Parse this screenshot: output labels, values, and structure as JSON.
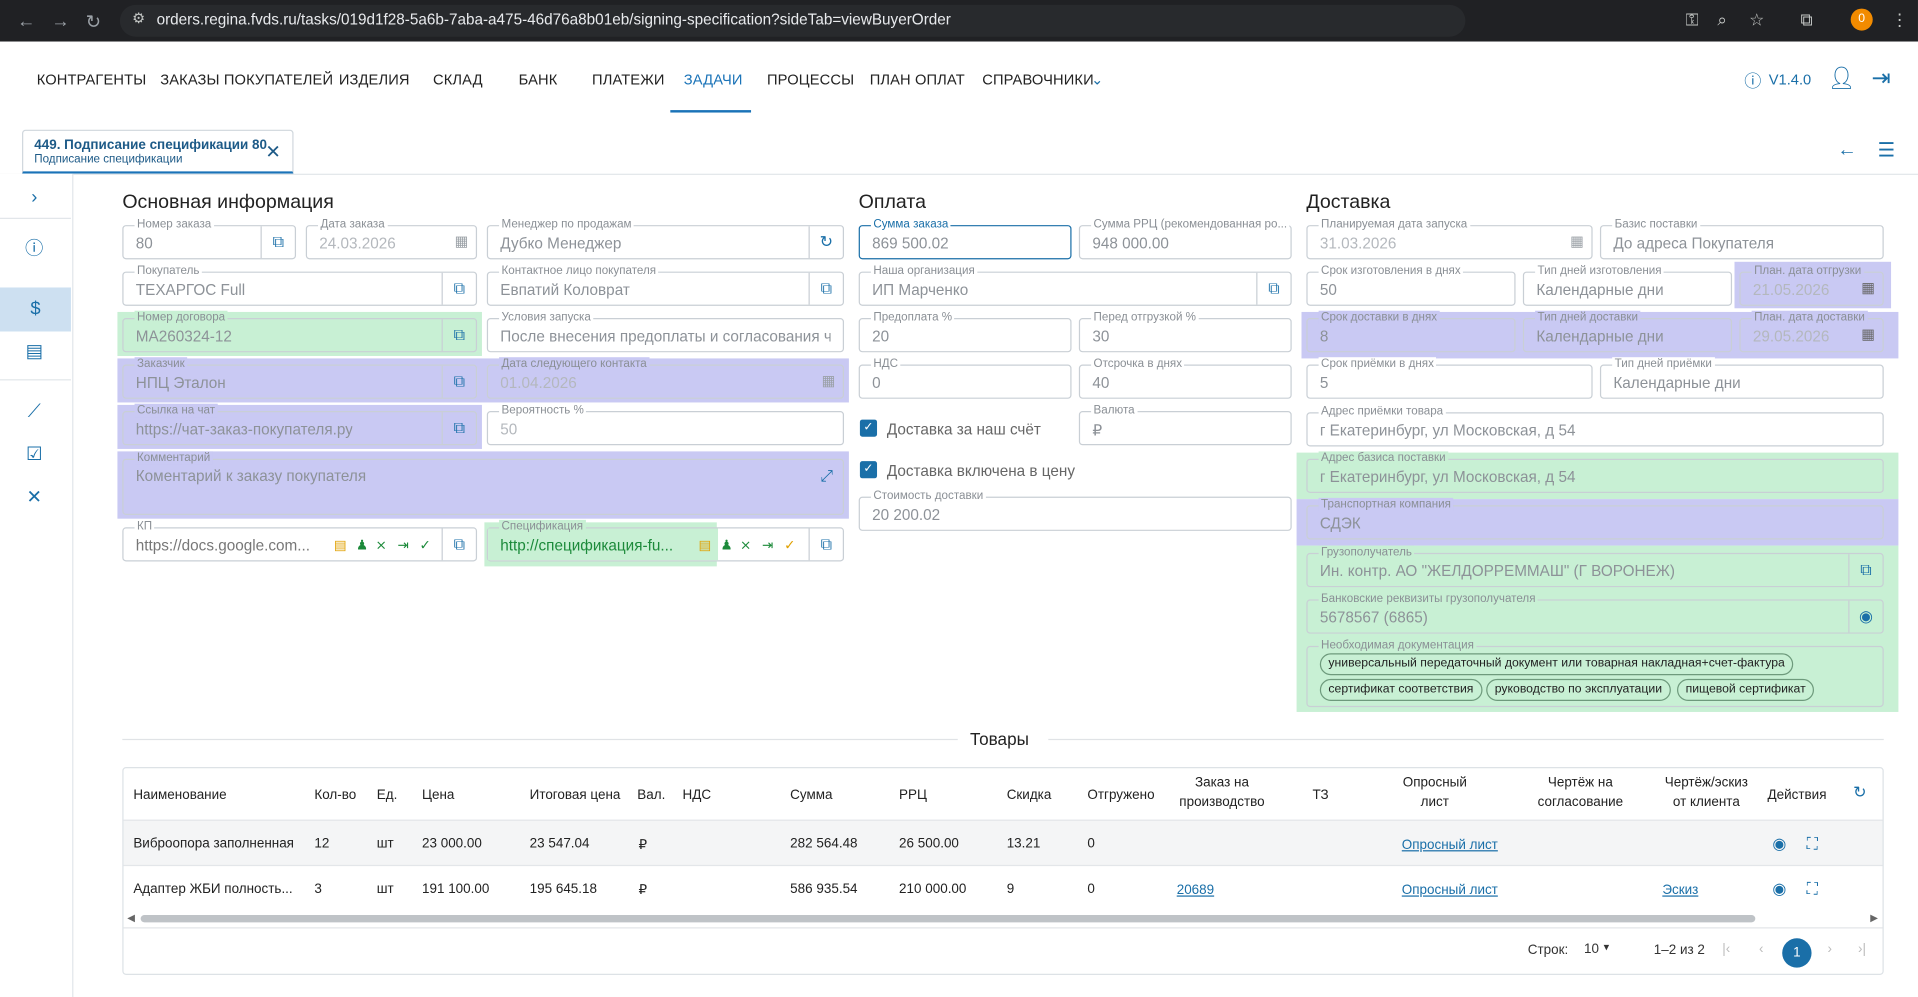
{
  "browser": {
    "url": "orders.regina.fvds.ru/tasks/019d1f28-5a6b-7aba-a475-46d76a8b01eb/signing-specification?sideTab=viewBuyerOrder",
    "profile": "0"
  },
  "nav": {
    "items": [
      "КОНТРАГЕНТЫ",
      "ЗАКАЗЫ ПОКУПАТЕЛЕЙ",
      "ИЗДЕЛИЯ",
      "СКЛАД",
      "БАНК",
      "ПЛАТЕЖИ",
      "ЗАДАЧИ",
      "ПРОЦЕССЫ",
      "ПЛАН ОПЛАТ",
      "СПРАВОЧНИКИ"
    ],
    "active": "ЗАДАЧИ",
    "version": "V1.4.0"
  },
  "tab": {
    "title": "449. Подписание спецификации 80",
    "subtitle": "Подписание спецификации"
  },
  "sections": {
    "main": "Основная информация",
    "payment": "Оплата",
    "delivery": "Доставка",
    "goods": "Товары"
  },
  "main": {
    "order_number": {
      "label": "Номер заказа",
      "value": "80"
    },
    "order_date": {
      "label": "Дата заказа",
      "value": "24.03.2026"
    },
    "manager": {
      "label": "Менеджер по продажам",
      "value": "Дубко Менеджер"
    },
    "buyer": {
      "label": "Покупатель",
      "value": "ТЕХАРГОС Full"
    },
    "contact": {
      "label": "Контактное лицо покупателя",
      "value": "Евпатий Коловрат"
    },
    "contract": {
      "label": "Номер договора",
      "value": "МА260324-12"
    },
    "launch_terms": {
      "label": "Условия запуска",
      "value": "После внесения предоплаты и согласования чертежей"
    },
    "customer": {
      "label": "Заказчик",
      "value": "НПЦ Эталон"
    },
    "next_contact": {
      "label": "Дата следующего контакта",
      "value": "01.04.2026"
    },
    "chat": {
      "label": "Ссылка на чат",
      "value": "https://чат-заказ-покупателя.ру"
    },
    "probability": {
      "label": "Вероятность %",
      "value": "50"
    },
    "comment": {
      "label": "Комментарий",
      "value": "Коментарий к заказу покупателя"
    },
    "kp": {
      "label": "КП",
      "value": "https://docs.google.com..."
    },
    "spec": {
      "label": "Спецификация",
      "value": "http://спецификация-fu..."
    }
  },
  "payment": {
    "sum": {
      "label": "Сумма заказа",
      "value": "869 500.02"
    },
    "rrp_sum": {
      "label": "Сумма РРЦ (рекомендованная ро...",
      "value": "948 000.00"
    },
    "org": {
      "label": "Наша организация",
      "value": "ИП Марченко"
    },
    "prepay": {
      "label": "Предоплата %",
      "value": "20"
    },
    "before_ship": {
      "label": "Перед отгрузкой %",
      "value": "30"
    },
    "vat": {
      "label": "НДС",
      "value": "0"
    },
    "deferral": {
      "label": "Отсрочка в днях",
      "value": "40"
    },
    "delivery_ours": {
      "label": "Доставка за наш счёт",
      "checked": true
    },
    "currency": {
      "label": "Валюта",
      "value": "₽"
    },
    "delivery_incl": {
      "label": "Доставка включена в цену",
      "checked": true
    },
    "delivery_cost": {
      "label": "Стоимость доставки",
      "value": "20 200.02"
    }
  },
  "delivery": {
    "launch_date": {
      "label": "Планируемая дата запуска",
      "value": "31.03.2026"
    },
    "basis": {
      "label": "Базис поставки",
      "value": "До адреса Покупателя"
    },
    "mfg_days": {
      "label": "Срок изготовления в днях",
      "value": "50"
    },
    "mfg_type": {
      "label": "Тип дней изготовления",
      "value": "Календарные дни"
    },
    "ship_date": {
      "label": "План. дата отгрузки",
      "value": "21.05.2026"
    },
    "dlv_days": {
      "label": "Срок доставки в днях",
      "value": "8"
    },
    "dlv_type": {
      "label": "Тип дней доставки",
      "value": "Календарные дни"
    },
    "dlv_date": {
      "label": "План. дата доставки",
      "value": "29.05.2026"
    },
    "acc_days": {
      "label": "Срок приёмки в днях",
      "value": "5"
    },
    "acc_type": {
      "label": "Тип дней приёмки",
      "value": "Календарные дни"
    },
    "acc_addr": {
      "label": "Адрес приёмки товара",
      "value": "г Екатеринбург, ул Московская, д 54"
    },
    "basis_addr": {
      "label": "Адрес базиса поставки",
      "value": "г Екатеринбург, ул Московская, д 54"
    },
    "carrier": {
      "label": "Транспортная компания",
      "value": "СДЭК"
    },
    "consignee": {
      "label": "Грузополучатель",
      "value": "Ин. контр. АО \"ЖЕЛДОРРЕММАШ\" (Г ВОРОНЕЖ)"
    },
    "bank": {
      "label": "Банковские реквизиты грузополучателя",
      "value": "5678567 (6865)"
    },
    "docs": {
      "label": "Необходимая документация",
      "chips": [
        "универсальный передаточный документ или товарная накладная+счет-фактура",
        "сертификат соответствия",
        "руководство по эксплуатации",
        "пищевой сертификат"
      ]
    }
  },
  "table": {
    "headers": {
      "name": "Наименование",
      "qty": "Кол-во",
      "unit": "Ед.",
      "price": "Цена",
      "total": "Итоговая цена",
      "cur": "Вал.",
      "vat": "НДС",
      "sum": "Сумма",
      "rrp": "РРЦ",
      "disc": "Скидка",
      "shipped": "Отгружено",
      "prod1": "Заказ на",
      "prod2": "производство",
      "tz": "ТЗ",
      "q1": "Опросный",
      "q2": "лист",
      "d1": "Чертёж на",
      "d2": "согласование",
      "c1": "Чертёж/эскиз",
      "c2": "от клиента",
      "actions": "Действия"
    },
    "rows": [
      {
        "name": "Виброопора заполненная",
        "qty": "12",
        "unit": "шт",
        "price": "23 000.00",
        "total": "23 547.04",
        "cur": "₽",
        "sum": "282 564.48",
        "rrp": "26 500.00",
        "disc": "13.21",
        "shipped": "0",
        "prod": "",
        "quest": "Опросный лист",
        "sketch": ""
      },
      {
        "name": "Адаптер ЖБИ полность...",
        "qty": "3",
        "unit": "шт",
        "price": "191 100.00",
        "total": "195 645.18",
        "cur": "₽",
        "sum": "586 935.54",
        "rrp": "210 000.00",
        "disc": "9",
        "shipped": "0",
        "prod": "20689",
        "quest": "Опросный лист",
        "sketch": "Эскиз"
      }
    ],
    "pagination": {
      "rows_label": "Строк:",
      "rows_value": "10",
      "range": "1–2 из 2",
      "page": "1"
    }
  }
}
